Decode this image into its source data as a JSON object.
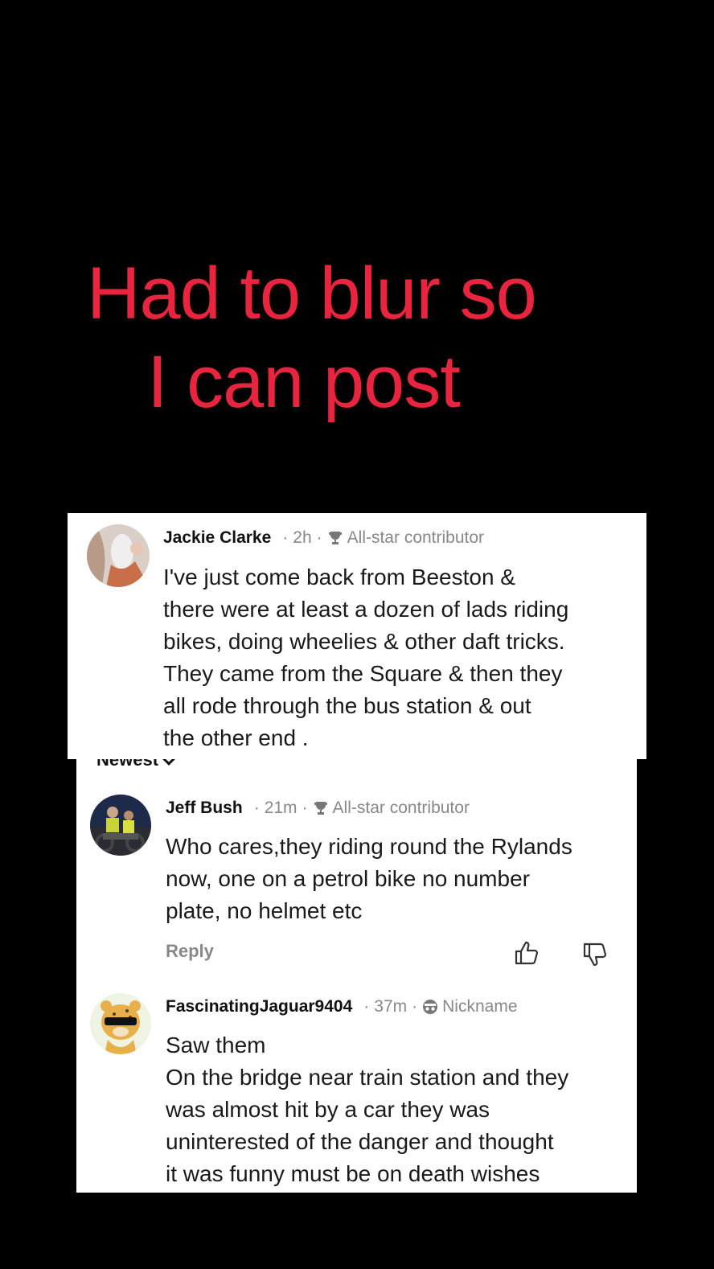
{
  "overlay": {
    "line1": "Had to blur so",
    "line2": "I can post"
  },
  "sort": {
    "label": "Newest"
  },
  "comments": [
    {
      "name": "Jackie Clarke",
      "time": "2h",
      "badge": "All-star contributor",
      "badge_icon": "trophy-icon",
      "lines": [
        "I've just come back from Beeston &",
        "there were at least a dozen of lads riding",
        "bikes, doing wheelies & other daft tricks.",
        "They came from the Square & then they",
        "all rode through the bus station & out",
        "the other end ."
      ]
    },
    {
      "name": "Jeff Bush",
      "time": "21m",
      "badge": "All-star contributor",
      "badge_icon": "trophy-icon",
      "lines": [
        "Who cares,they riding round the Rylands",
        "now, one on a petrol bike no number",
        "plate, no helmet etc"
      ],
      "reply": "Reply"
    },
    {
      "name": "FascinatingJaguar9404",
      "time": "37m",
      "badge": "Nickname",
      "badge_icon": "incognito-icon",
      "lines": [
        "Saw them",
        "On the bridge near train station and they",
        "was almost hit by a car they was",
        "uninterested of the danger and thought",
        "it was funny must be on death wishes"
      ]
    }
  ],
  "colors": {
    "headline": "#e8243f",
    "background": "#000000",
    "card": "#ffffff"
  }
}
